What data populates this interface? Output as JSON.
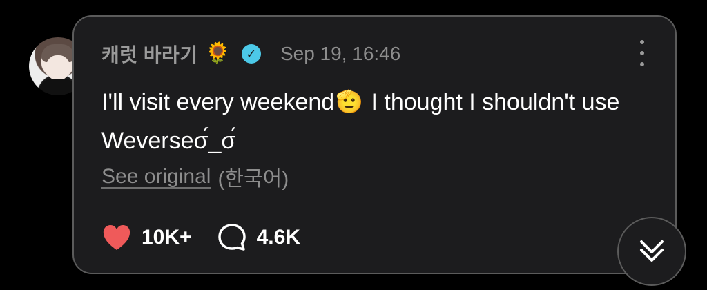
{
  "post": {
    "username": "캐럿 바라기",
    "username_emoji": "🌻",
    "timestamp": "Sep 19, 16:46",
    "text_part1": "I'll visit every weekend",
    "text_emoji": "🫡",
    "text_part2": " I thought I shouldn't use Weverseσ́_σ́",
    "see_original_label": "See original",
    "original_language": "(한국어)"
  },
  "stats": {
    "likes": "10K+",
    "comments": "4.6K"
  },
  "colors": {
    "heart": "#ef5a5a",
    "verified": "#4cc9e8",
    "card_background": "#1c1c1e",
    "card_border": "#5b5b5b"
  },
  "icons": {
    "avatar": "profile-avatar",
    "verified": "verified-badge-icon",
    "more": "more-vertical-icon",
    "like": "heart-icon",
    "comment": "comment-icon",
    "scroll": "double-chevron-down-icon"
  }
}
